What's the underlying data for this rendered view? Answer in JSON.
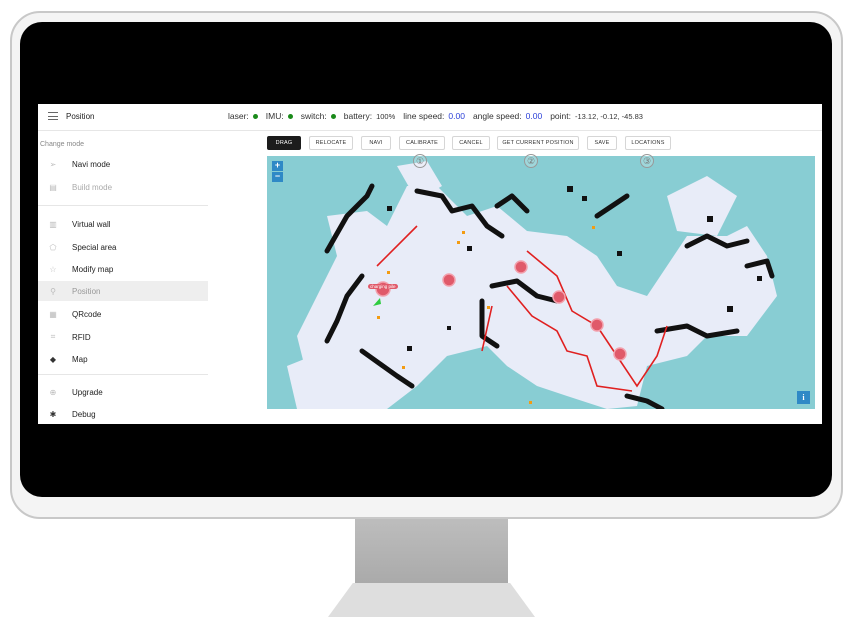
{
  "topbar": {
    "title": "Position",
    "laser_label": "laser:",
    "imu_label": "IMU:",
    "switch_label": "switch:",
    "battery_label": "battery:",
    "battery_value": "100%",
    "line_speed_label": "line speed:",
    "line_speed_value": "0.00",
    "angle_speed_label": "angle speed:",
    "angle_speed_value": "0.00",
    "point_label": "point:",
    "point_value": "-13.12,  -0.12,  -45.83",
    "status_color": "#1a8a1a",
    "speed_color": "#2a3fd8"
  },
  "sidebar": {
    "header": "Change mode",
    "items": [
      {
        "label": "Navi mode",
        "icon": "send-icon"
      },
      {
        "label": "Build mode",
        "icon": "map-build-icon"
      },
      {
        "label": "Virtual wall",
        "icon": "wall-icon"
      },
      {
        "label": "Special area",
        "icon": "pentagon-icon"
      },
      {
        "label": "Modify map",
        "icon": "star-icon"
      },
      {
        "label": "Position",
        "icon": "location-icon"
      },
      {
        "label": "QRcode",
        "icon": "qrcode-icon"
      },
      {
        "label": "RFID",
        "icon": "rfid-icon"
      },
      {
        "label": "Map",
        "icon": "layers-icon"
      },
      {
        "label": "Upgrade",
        "icon": "upload-icon"
      },
      {
        "label": "Debug",
        "icon": "bug-icon"
      }
    ]
  },
  "toolbar": {
    "drag": "DRAG",
    "relocate": "RELOCATE",
    "navi": "NAVI",
    "calibrate": "CALIBRATE",
    "cancel": "CANCEL",
    "get_current_position": "GET CURRENT POSITION",
    "save": "SAVE",
    "locations": "LOCATIONS"
  },
  "annotations": [
    "①",
    "②",
    "③"
  ],
  "map": {
    "zoom_in": "+",
    "zoom_out": "−",
    "info": "i",
    "charging_pile_label": "charging pile",
    "map_color": "#88cdd3",
    "free_space_color": "#e8ecf8",
    "wall_color": "#111111",
    "path_color": "#e02020",
    "waypoint_color": "#e05a6a"
  }
}
